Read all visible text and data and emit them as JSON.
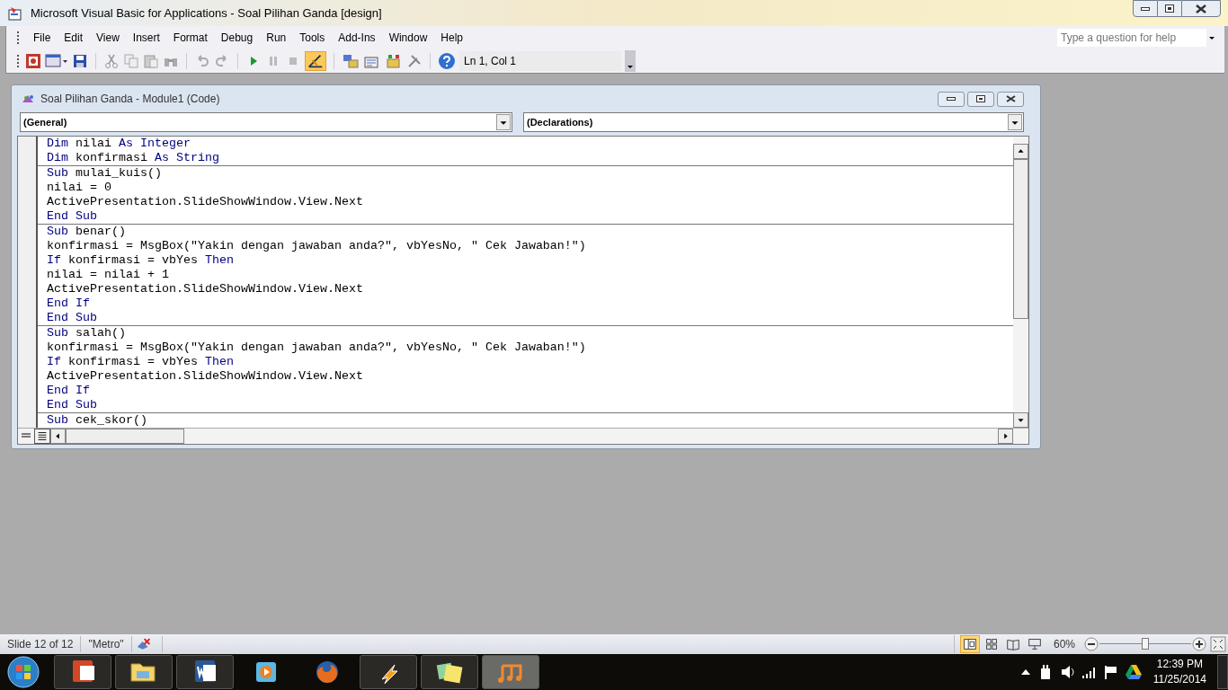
{
  "window": {
    "title": "Microsoft Visual Basic for Applications - Soal Pilihan Ganda [design]"
  },
  "menu": [
    "File",
    "Edit",
    "View",
    "Insert",
    "Format",
    "Debug",
    "Run",
    "Tools",
    "Add-Ins",
    "Window",
    "Help"
  ],
  "help_box": {
    "placeholder": "Type a question for help"
  },
  "toolbar": {
    "design_mode": true,
    "position": "Ln 1, Col 1"
  },
  "code_window": {
    "title": "Soal Pilihan Ganda - Module1 (Code)",
    "object_box": "(General)",
    "procedure_box": "(Declarations)",
    "blocks": [
      [
        [
          {
            "kind": "keyword",
            "text": "Dim"
          },
          {
            "kind": "plain",
            "text": " nilai "
          },
          {
            "kind": "keyword",
            "text": "As Integer"
          }
        ],
        [
          {
            "kind": "keyword",
            "text": "Dim"
          },
          {
            "kind": "plain",
            "text": " konfirmasi "
          },
          {
            "kind": "keyword",
            "text": "As String"
          }
        ]
      ],
      [
        [
          {
            "kind": "keyword",
            "text": "Sub"
          },
          {
            "kind": "plain",
            "text": " mulai_kuis()"
          }
        ],
        [
          {
            "kind": "plain",
            "text": "nilai = 0"
          }
        ],
        [
          {
            "kind": "plain",
            "text": "ActivePresentation.SlideShowWindow.View.Next"
          }
        ],
        [
          {
            "kind": "keyword",
            "text": "End Sub"
          }
        ]
      ],
      [
        [
          {
            "kind": "keyword",
            "text": "Sub"
          },
          {
            "kind": "plain",
            "text": " benar()"
          }
        ],
        [
          {
            "kind": "plain",
            "text": "konfirmasi = MsgBox(\"Yakin dengan jawaban anda?\", vbYesNo, \" Cek Jawaban!\")"
          }
        ],
        [
          {
            "kind": "keyword",
            "text": "If"
          },
          {
            "kind": "plain",
            "text": " konfirmasi = vbYes "
          },
          {
            "kind": "keyword",
            "text": "Then"
          }
        ],
        [
          {
            "kind": "plain",
            "text": "nilai = nilai + 1"
          }
        ],
        [
          {
            "kind": "plain",
            "text": "ActivePresentation.SlideShowWindow.View.Next"
          }
        ],
        [
          {
            "kind": "keyword",
            "text": "End If"
          }
        ],
        [
          {
            "kind": "keyword",
            "text": "End Sub"
          }
        ]
      ],
      [
        [
          {
            "kind": "keyword",
            "text": "Sub"
          },
          {
            "kind": "plain",
            "text": " salah()"
          }
        ],
        [
          {
            "kind": "plain",
            "text": "konfirmasi = MsgBox(\"Yakin dengan jawaban anda?\", vbYesNo, \" Cek Jawaban!\")"
          }
        ],
        [
          {
            "kind": "keyword",
            "text": "If"
          },
          {
            "kind": "plain",
            "text": " konfirmasi = vbYes "
          },
          {
            "kind": "keyword",
            "text": "Then"
          }
        ],
        [
          {
            "kind": "plain",
            "text": "ActivePresentation.SlideShowWindow.View.Next"
          }
        ],
        [
          {
            "kind": "keyword",
            "text": "End If"
          }
        ],
        [
          {
            "kind": "keyword",
            "text": "End Sub"
          }
        ]
      ],
      [
        [
          {
            "kind": "keyword",
            "text": "Sub"
          },
          {
            "kind": "plain",
            "text": " cek_skor()"
          }
        ]
      ]
    ]
  },
  "status_bar": {
    "slide": "Slide 12 of 12",
    "theme": "\"Metro\"",
    "views": [
      {
        "kind": "normal",
        "selected": true
      },
      {
        "kind": "sorter",
        "selected": false
      },
      {
        "kind": "reading",
        "selected": false
      },
      {
        "kind": "slideshow",
        "selected": false
      }
    ],
    "zoom": "60%",
    "zoom_slider": {
      "level": 0.5
    }
  },
  "taskbar": {
    "apps": [
      {
        "kind": "powerpoint",
        "running": true,
        "selected": false
      },
      {
        "kind": "explorer",
        "running": true,
        "selected": false
      },
      {
        "kind": "word",
        "running": true,
        "selected": false
      },
      {
        "kind": "media",
        "running": false,
        "selected": false
      },
      {
        "kind": "firefox",
        "running": false,
        "selected": false
      },
      {
        "kind": "winamp",
        "running": true,
        "selected": false
      },
      {
        "kind": "notes",
        "running": true,
        "selected": false
      },
      {
        "kind": "music",
        "running": true,
        "selected": true
      }
    ],
    "clock": {
      "time": "12:39 PM",
      "date": "11/25/2014"
    }
  }
}
